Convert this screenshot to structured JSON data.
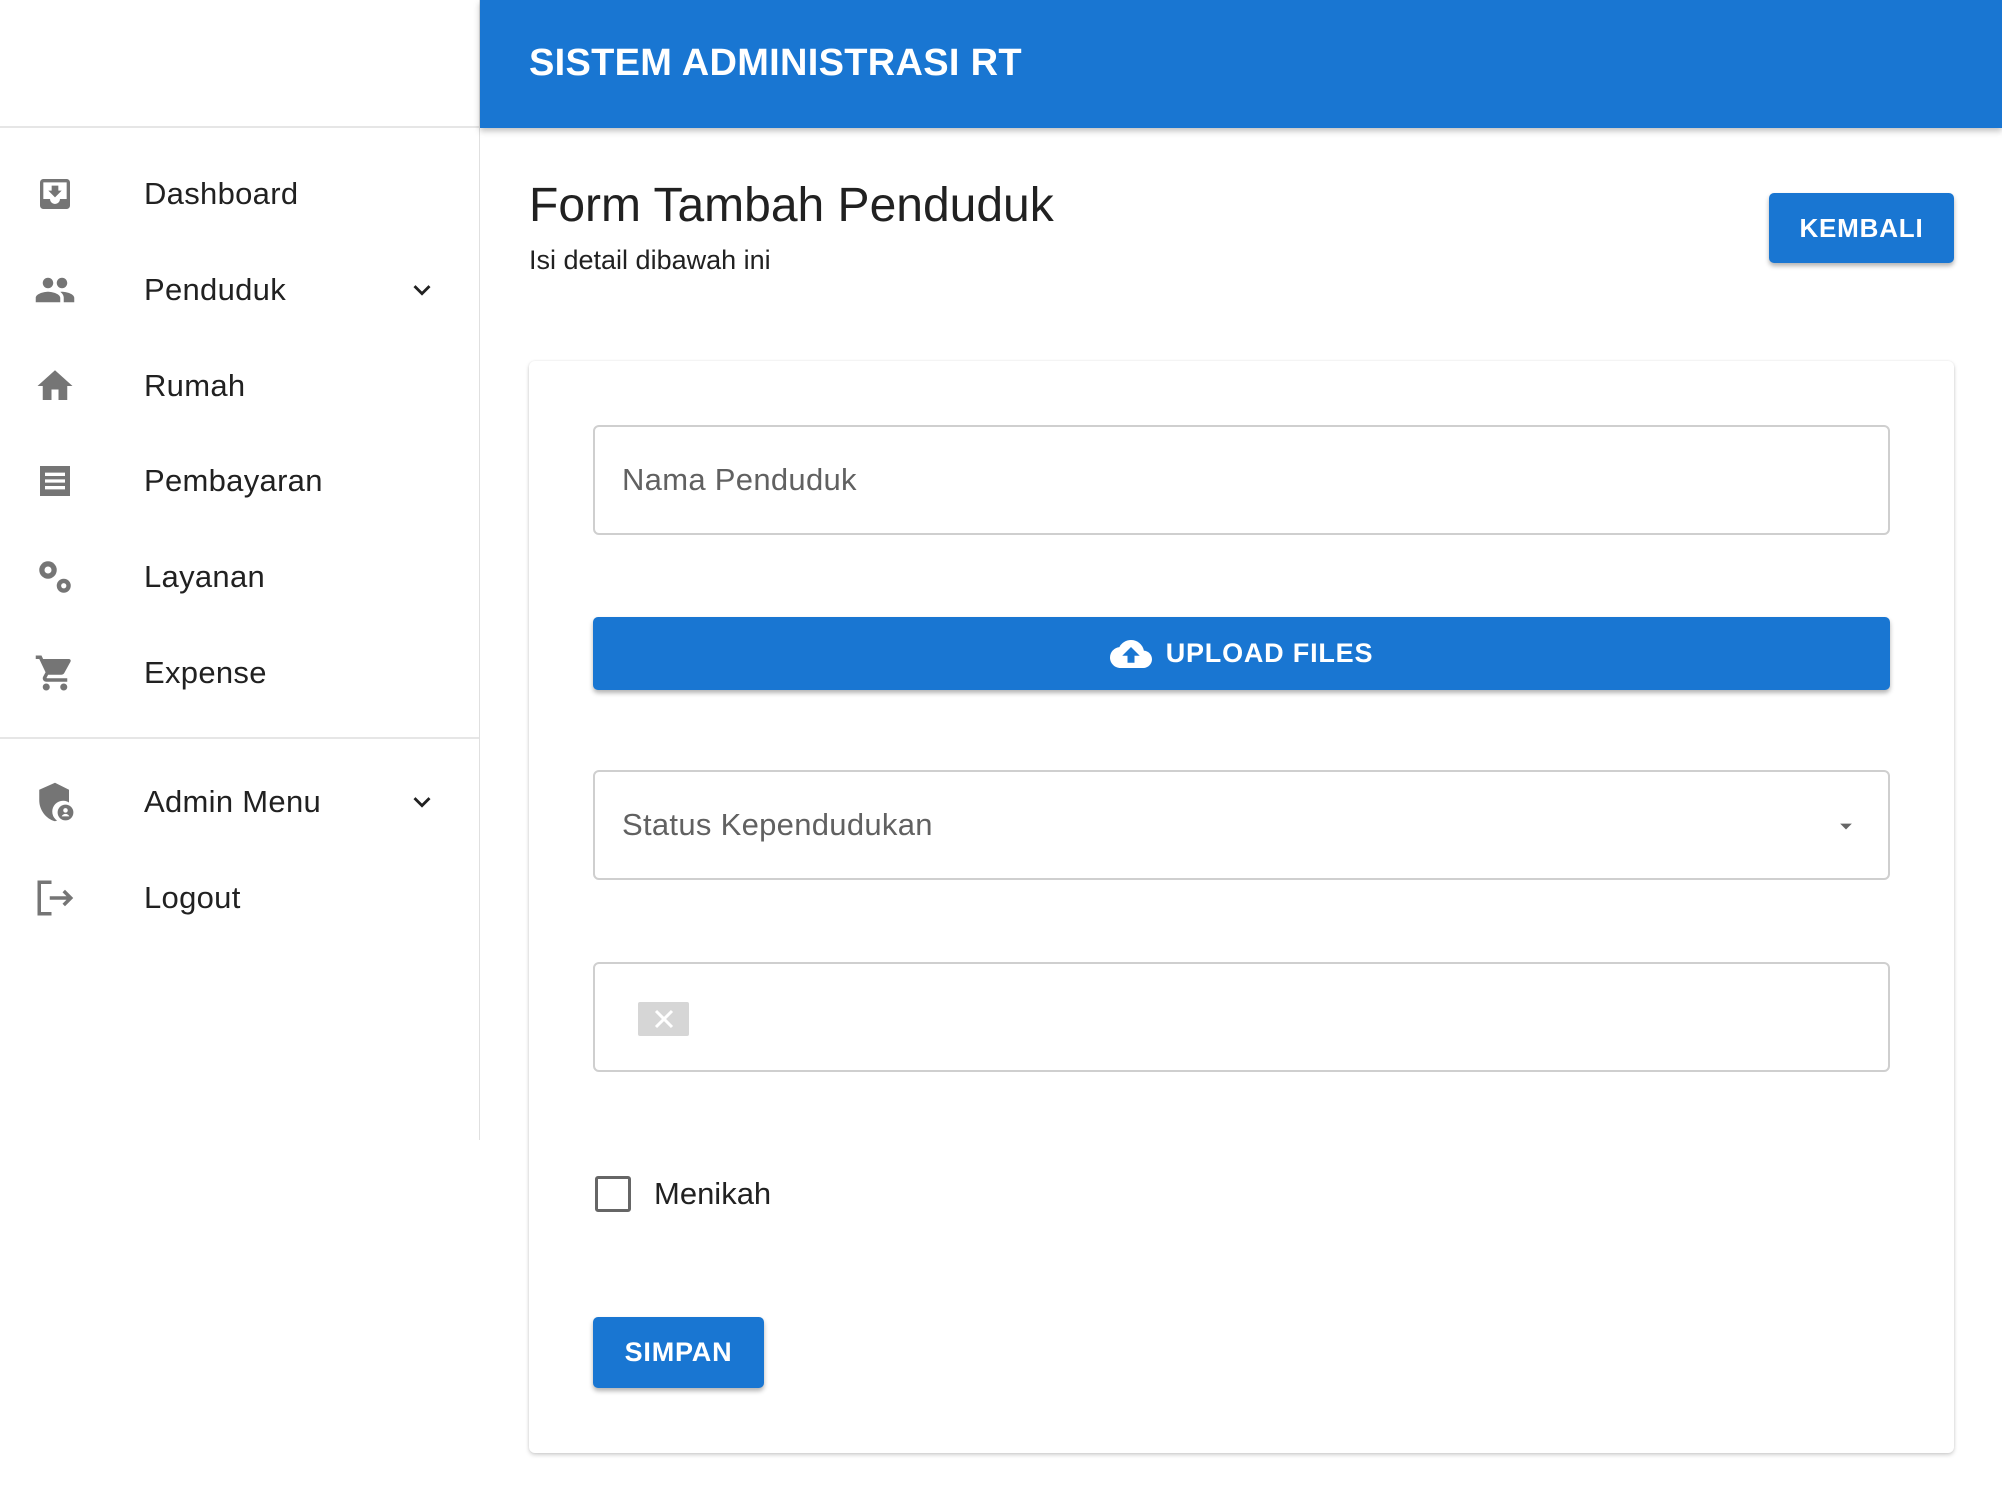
{
  "header": {
    "title": "SISTEM ADMINISTRASI RT",
    "color": "#1976d2"
  },
  "sidebar": {
    "items": [
      {
        "label": "Dashboard",
        "icon": "dashboard-inbox-icon"
      },
      {
        "label": "Penduduk",
        "icon": "people-icon",
        "expandable": true
      },
      {
        "label": "Rumah",
        "icon": "home-icon"
      },
      {
        "label": "Pembayaran",
        "icon": "receipt-icon"
      },
      {
        "label": "Layanan",
        "icon": "gears-icon"
      },
      {
        "label": "Expense",
        "icon": "cart-icon"
      }
    ],
    "bottom_items": [
      {
        "label": "Admin Menu",
        "icon": "admin-shield-icon",
        "expandable": true
      },
      {
        "label": "Logout",
        "icon": "logout-icon"
      }
    ]
  },
  "page": {
    "title": "Form Tambah Penduduk",
    "subtitle": "Isi detail dibawah ini",
    "back_label": "KEMBALI"
  },
  "form": {
    "name_placeholder": "Nama Penduduk",
    "upload_label": "UPLOAD FILES",
    "status_placeholder": "Status Kependudukan",
    "married_label": "Menikah",
    "married_checked": false,
    "save_label": "SIMPAN"
  }
}
